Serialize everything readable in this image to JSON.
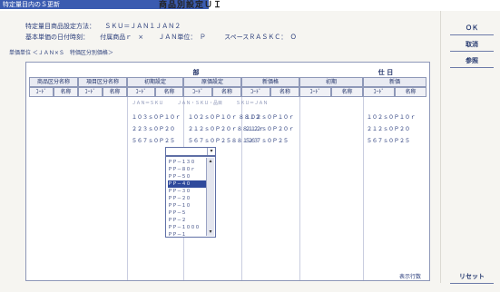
{
  "window": {
    "title": "特定量目内のＳ更新",
    "banner": "商品別設定ＵＩ"
  },
  "info": {
    "line1_label": "特定量目商品設定方法：",
    "line1_value": "ＳＫＵ＝ＪＡＮ１ＪＡＮ２",
    "line2_label": "基本単価の日付時刻：",
    "line2_a": "付属商品ｒ　×",
    "line2_b": "ＪＡＮ単位：　Ｐ",
    "line2_c": "スペースＲＡＳＫＣ：　Ｏ",
    "line3": "単価単位 ＜ＪＡＮ×Ｓ　特価区分別価格＞"
  },
  "buttons": {
    "ok": "ＯＫ",
    "btn2": "取消",
    "btn3": "参照",
    "reset": "リセット"
  },
  "band_labels": {
    "left": "部",
    "right": "仕 日"
  },
  "columns_top": [
    "商品区分名称",
    "項目区分名称",
    "初期設定",
    "原価設定",
    "新価格",
    "初期",
    "新価"
  ],
  "columns_sub": [
    "ｺｰﾄﾞ",
    "名称",
    "ｺｰﾄﾞ",
    "名称",
    "ｺｰﾄﾞ",
    "名称",
    "ｺｰﾄﾞ",
    "名称",
    "ｺｰﾄﾞ",
    "名称",
    "ｺｰﾄﾞ",
    "名称",
    "ｺｰﾄﾞ",
    "名称",
    "ｺｰﾄﾞ",
    "名称"
  ],
  "hint_text": "ＪＡＮ＝ＳＫＵ　　　ＪＡＮ・ＳＫＵ・品目　　　ＳＫＵ＝ＪＡＮ",
  "rows": [
    {
      "c1": "１０３ｓ０Ｐ１０ｒ",
      "c2": "１０２ｓ０Ｐ１０ｒ ８８１２",
      "c3": "１０２ｓ０Ｐ１０ｒ",
      "c4": "１０２ｓ０Ｐ１０ｒ"
    },
    {
      "c1": "２２３ｓ０Ｐ２０",
      "c2": "２１２ｓ０Ｐ２０ｒ８８１２ｒ",
      "c3": "２１２ｓ０Ｐ２０ｒ",
      "c4": "２１２ｓ０Ｐ２０"
    },
    {
      "c1": "５６７ｓ０Ｐ２５",
      "c2": "５６７ｓ０Ｐ２５８８１２３",
      "c3": "５６７ｓ０Ｐ２５",
      "c4": "５６７ｓ０Ｐ２５"
    }
  ],
  "dropdown": {
    "current": "",
    "items": [
      "ＰＰ－１３０",
      "ＰＰ－８０ｒ",
      "ＰＰ－５０",
      "ＰＰ－４０",
      "ＰＰ－３０",
      "ＰＰ－２０",
      "ＰＰ－１０",
      "ＰＰ－５",
      "ＰＰ－２",
      "ＰＰ－１０００",
      "ＰＰ－１"
    ],
    "selected_index": 3
  },
  "footer": {
    "status": "表示行数"
  },
  "colors": {
    "accent": "#2f4a9c",
    "title_bar": "#3a5bb0",
    "text": "#2a3d7a"
  }
}
